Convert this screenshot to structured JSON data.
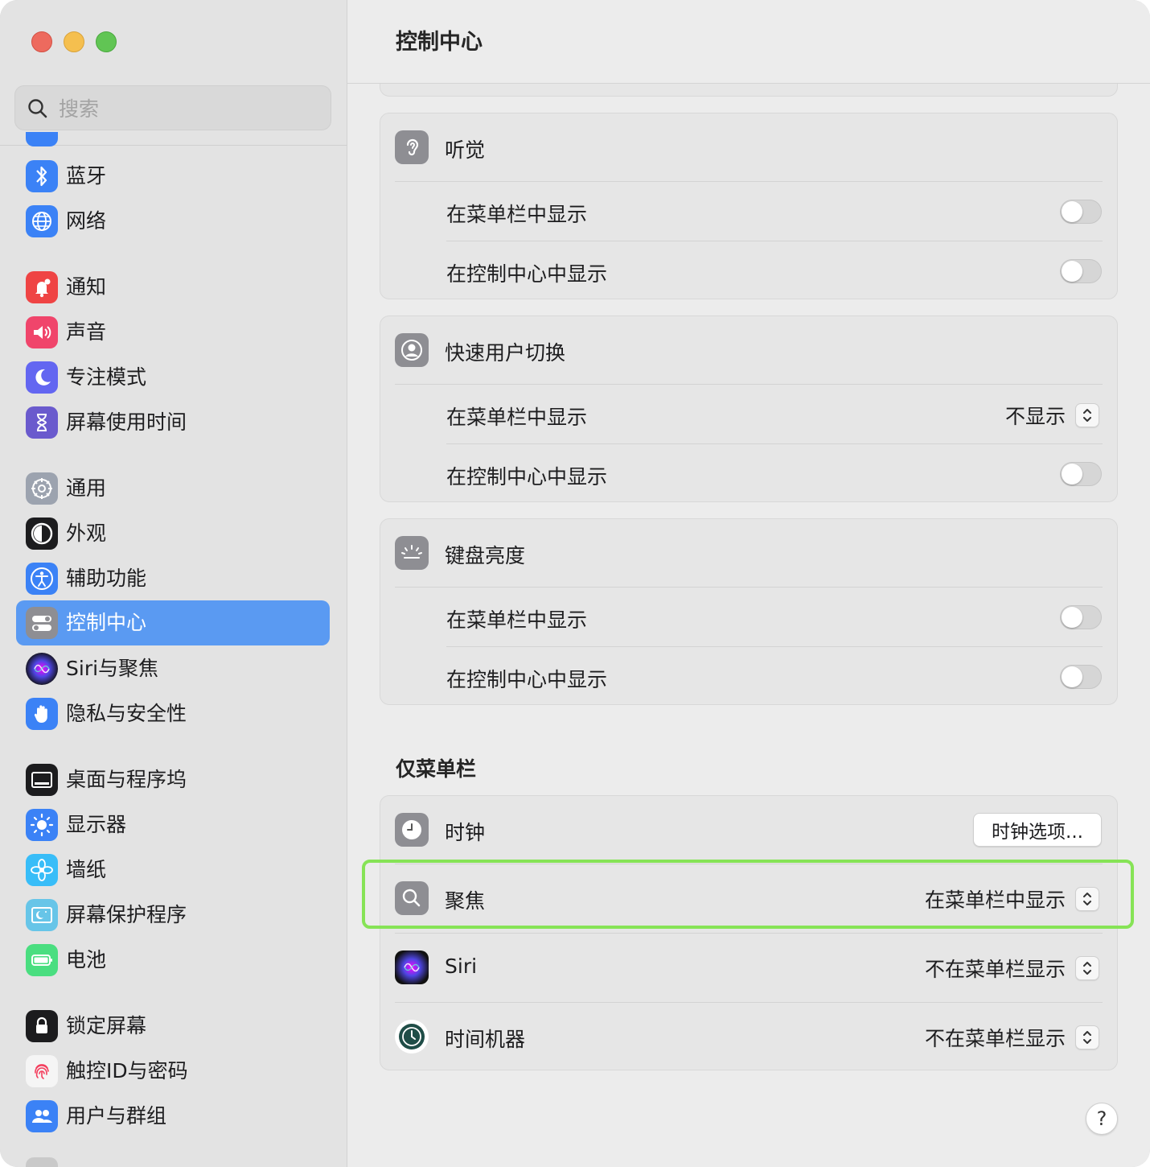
{
  "window": {
    "title": "控制中心"
  },
  "search": {
    "placeholder": "搜索"
  },
  "sidebar": {
    "items": [
      {
        "label": "蓝牙",
        "icon": "bluetooth-icon"
      },
      {
        "label": "网络",
        "icon": "network-globe-icon"
      },
      {
        "label": "通知",
        "icon": "bell-icon"
      },
      {
        "label": "声音",
        "icon": "speaker-icon"
      },
      {
        "label": "专注模式",
        "icon": "moon-icon"
      },
      {
        "label": "屏幕使用时间",
        "icon": "hourglass-icon"
      },
      {
        "label": "通用",
        "icon": "gear-icon"
      },
      {
        "label": "外观",
        "icon": "appearance-icon"
      },
      {
        "label": "辅助功能",
        "icon": "accessibility-icon"
      },
      {
        "label": "控制中心",
        "icon": "control-center-icon",
        "selected": true
      },
      {
        "label": "Siri与聚焦",
        "icon": "siri-icon"
      },
      {
        "label": "隐私与安全性",
        "icon": "hand-icon"
      },
      {
        "label": "桌面与程序坞",
        "icon": "dock-icon"
      },
      {
        "label": "显示器",
        "icon": "sun-icon"
      },
      {
        "label": "墙纸",
        "icon": "flower-icon"
      },
      {
        "label": "屏幕保护程序",
        "icon": "screensaver-icon"
      },
      {
        "label": "电池",
        "icon": "battery-icon"
      },
      {
        "label": "锁定屏幕",
        "icon": "lock-icon"
      },
      {
        "label": "触控ID与密码",
        "icon": "fingerprint-icon"
      },
      {
        "label": "用户与群组",
        "icon": "users-icon"
      }
    ]
  },
  "main": {
    "hearing": {
      "title": "听觉",
      "menubar_label": "在菜单栏中显示",
      "control_center_label": "在控制中心中显示",
      "menubar_on": false,
      "control_center_on": false
    },
    "fast_user_switching": {
      "title": "快速用户切换",
      "menubar_label": "在菜单栏中显示",
      "menubar_value": "不显示",
      "control_center_label": "在控制中心中显示",
      "control_center_on": false
    },
    "keyboard_brightness": {
      "title": "键盘亮度",
      "menubar_label": "在菜单栏中显示",
      "control_center_label": "在控制中心中显示",
      "menubar_on": false,
      "control_center_on": false
    },
    "menubar_only_title": "仅菜单栏",
    "clock": {
      "title": "时钟",
      "button_label": "时钟选项..."
    },
    "spotlight": {
      "title": "聚焦",
      "value": "在菜单栏中显示"
    },
    "siri": {
      "title": "Siri",
      "value": "不在菜单栏显示"
    },
    "time_machine": {
      "title": "时间机器",
      "value": "不在菜单栏显示"
    },
    "help_label": "?"
  },
  "colors": {
    "selection": "#5a9af2",
    "highlight_outline": "#86e356"
  }
}
